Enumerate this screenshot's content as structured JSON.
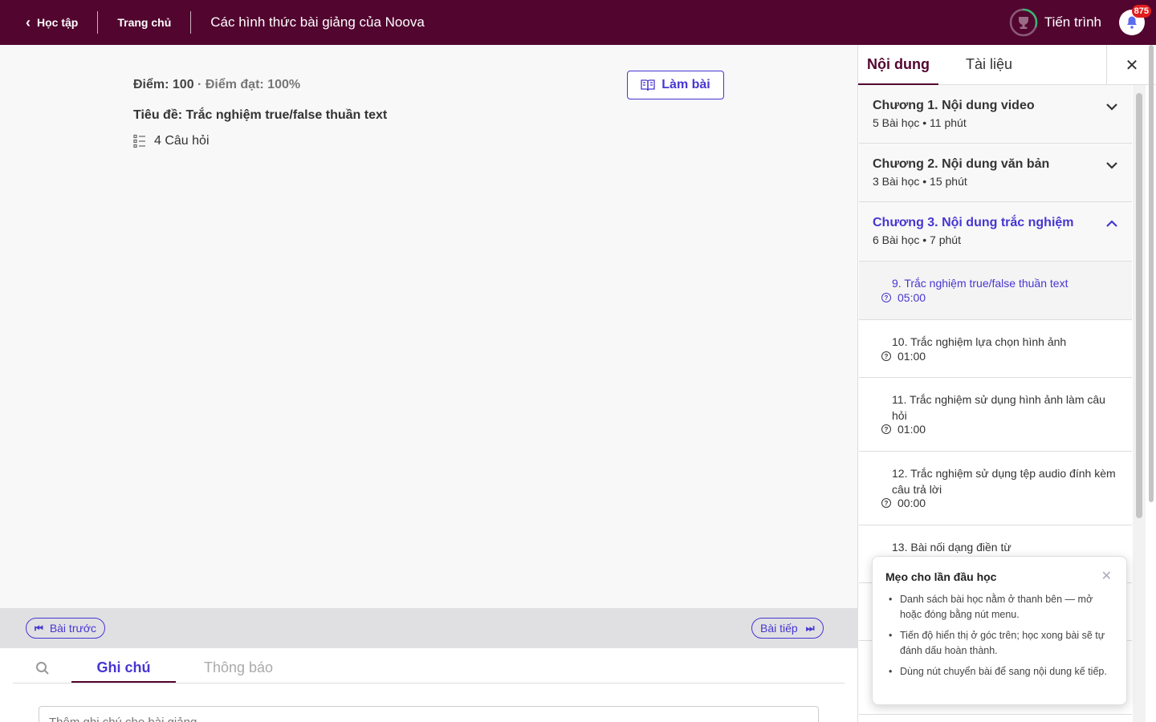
{
  "header": {
    "back_label": "Học tập",
    "home_label": "Trang chủ",
    "course_title": "Các hình thức bài giảng của Noova",
    "progress_label": "Tiến trình",
    "progress_fraction": 0.3,
    "notification_count": "875"
  },
  "quiz": {
    "score": "Điểm: 100",
    "pass_score": "· Điểm đạt: 100%",
    "title": "Tiêu đề: Trắc nghiệm true/false thuần text",
    "question_count": "4 Câu hỏi",
    "start_label": "Làm bài"
  },
  "nav": {
    "prev_label": "Bài trước",
    "next_label": "Bài tiếp"
  },
  "notes": {
    "tab_notes": "Ghi chú",
    "tab_announcements": "Thông báo",
    "placeholder": "Thêm ghi chú cho bài giảng"
  },
  "sidebar": {
    "tab_content": "Nội dung",
    "tab_materials": "Tài liệu",
    "chapters": [
      {
        "title": "Chương 1. Nội dung video",
        "meta": "5 Bài học • 11 phút"
      },
      {
        "title": "Chương 2. Nội dung văn bản",
        "meta": "3 Bài học • 15 phút"
      },
      {
        "title": "Chương 3. Nội dung trắc nghiệm",
        "meta": "6 Bài học • 7 phút"
      }
    ],
    "lessons": [
      {
        "title": "9. Trắc nghiệm true/false thuần text",
        "duration": "05:00"
      },
      {
        "title": "10. Trắc nghiệm lựa chọn hình ảnh",
        "duration": "01:00"
      },
      {
        "title": "11. Trắc nghiệm sử dụng hình ảnh làm câu hỏi",
        "duration": "01:00"
      },
      {
        "title": "12. Trắc nghiệm sử dụng tệp audio đính kèm câu trả lời",
        "duration": "00:00"
      },
      {
        "title": "13. Bài nối dạng điền từ"
      }
    ]
  },
  "tips": {
    "title": "Mẹo cho lần đầu học",
    "items": [
      "Danh sách bài học nằm ở thanh bên — mở hoặc đóng bằng nút menu.",
      "Tiến độ hiển thị ở góc trên; học xong bài sẽ tự đánh dấu hoàn thành.",
      "Dùng nút chuyển bài để sang nội dung kế tiếp."
    ]
  },
  "colors": {
    "header_bg": "#52052f",
    "accent": "#4636d1",
    "progress_ring": "#3cb371",
    "badge": "#e01e1e",
    "bell": "#5b6cf0"
  }
}
